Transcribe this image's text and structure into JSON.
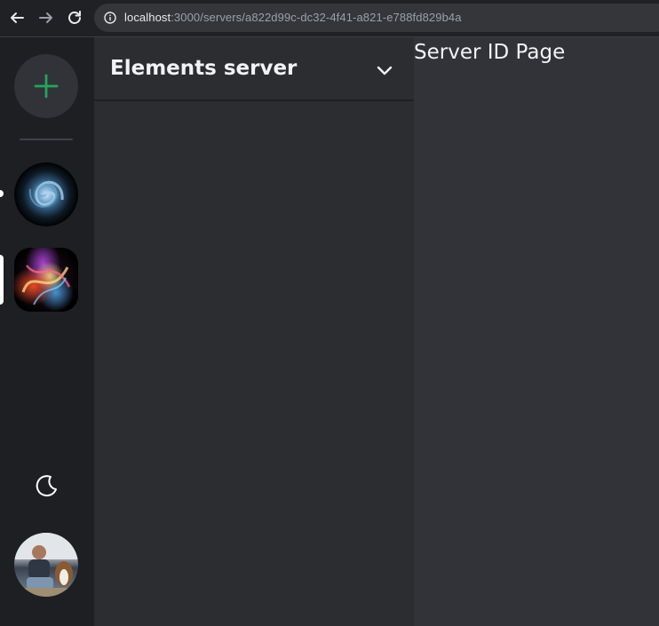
{
  "browser": {
    "url_host": "localhost",
    "url_path": ":3000/servers/a822d99c-dc32-4f41-a821-e788fd829b4a",
    "icons": [
      "back-arrow-icon",
      "forward-arrow-icon",
      "reload-icon",
      "info-icon"
    ]
  },
  "server_rail": {
    "add_server_icon": "plus-icon",
    "accent": "#23a55a",
    "servers": [
      {
        "name": "server-1",
        "icon": "galaxy-image",
        "indicator": "unread-dot"
      },
      {
        "name": "server-2",
        "icon": "abstract-art-image",
        "indicator": "active-pill",
        "active": true
      }
    ],
    "theme_toggle_icon": "moon-icon",
    "user_avatar": "user-avatar-photo"
  },
  "channel_panel": {
    "server_name": "Elements server",
    "dropdown_icon": "chevron-down-icon"
  },
  "main": {
    "title": "Server ID Page"
  }
}
